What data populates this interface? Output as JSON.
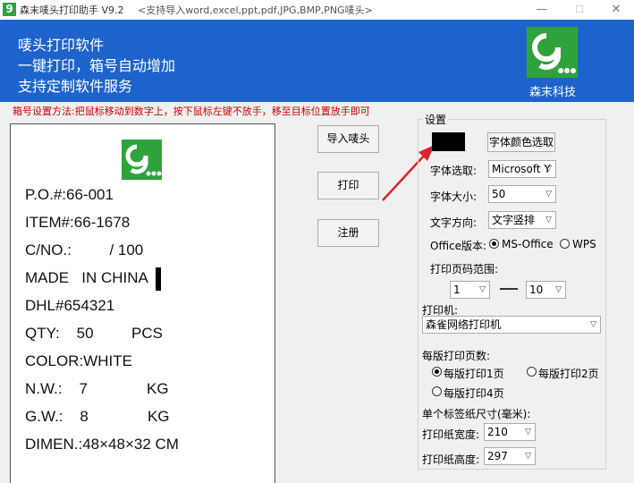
{
  "window": {
    "title": "森末唛头打印助手  V9.2",
    "subtitle": "<支持导入word,excel,ppt,pdf,JPG,BMP,PNG唛头>",
    "minimize": "—",
    "maximize": "☐",
    "close": "✕"
  },
  "banner": {
    "line1": "唛头打印软件",
    "line2": "一键打印，箱号自动增加",
    "line3": "支持定制软件服务",
    "brand": "森末科技"
  },
  "hint": "箱号设置方法:把鼠标移动到数字上，按下鼠标左键不放手，移至目标位置放手即可",
  "label": {
    "po": "P.O.#:66-001",
    "item": "ITEM#:66-1678",
    "cno": "C/NO.:         / 100",
    "made": "MADE   IN CHINA",
    "dhl": "DHL#654321",
    "qty": "QTY:    50         PCS",
    "color": "COLOR:WHITE",
    "nw": "N.W.:    7              KG",
    "gw": "G.W.:    8              KG",
    "dimen": "DIMEN.:48×48×32 CM"
  },
  "buttons": {
    "import": "导入唛头",
    "print": "打印",
    "register": "注册"
  },
  "settings": {
    "legend": "设置",
    "font_color_btn": "字体颜色选取",
    "font_select_label": "字体选取:",
    "font_select_value": "Microsoft Y",
    "font_size_label": "字体大小:",
    "font_size_value": "50",
    "text_dir_label": "文字方向:",
    "text_dir_value": "文字竖排",
    "office_label": "Office版本:",
    "office_ms": "MS-Office",
    "office_wps": "WPS",
    "page_range_label": "打印页码范围:",
    "page_from": "1",
    "page_to": "10",
    "printer_label": "打印机:",
    "printer_value": "森雀网络打印机",
    "per_page_label": "每版打印页数:",
    "per_page_1": "每版打印1页",
    "per_page_2": "每版打印2页",
    "per_page_4": "每版打印4页",
    "label_size_label": "单个标签纸尺寸(毫米):",
    "width_label": "打印纸宽度:",
    "width_value": "210",
    "height_label": "打印纸高度:",
    "height_value": "297"
  },
  "colors": {
    "banner": "#1e63cc",
    "logo_green": "#2fa33b",
    "hint_red": "#cc0000"
  }
}
